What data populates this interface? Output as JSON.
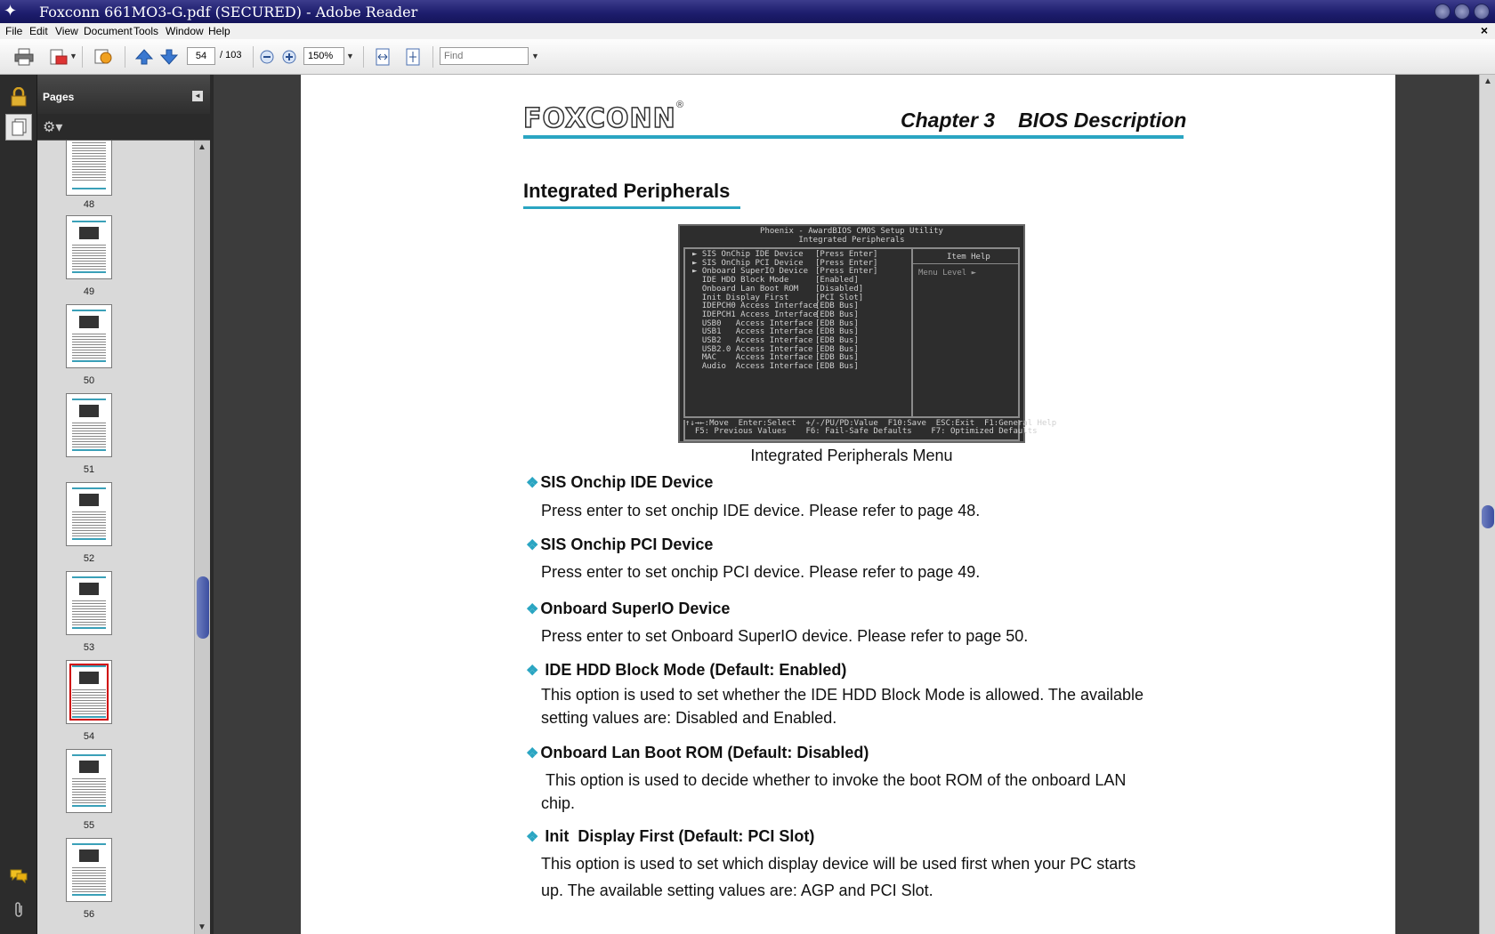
{
  "window": {
    "title": "Foxconn 661MO3-G.pdf (SECURED) - Adobe Reader"
  },
  "menu": [
    "File",
    "Edit",
    "View",
    "Document",
    "Tools",
    "Window",
    "Help"
  ],
  "toolbar": {
    "current_page": "54",
    "total_pages": "/ 103",
    "zoom": "150%",
    "find_placeholder": "Find"
  },
  "pages_panel": {
    "title": "Pages",
    "thumbnails": [
      "48",
      "49",
      "50",
      "51",
      "52",
      "53",
      "54",
      "55",
      "56"
    ],
    "selected": "54"
  },
  "doc": {
    "logo": "FOXCONN",
    "logo_mark": "®",
    "chapter": "Chapter 3",
    "chapter_title": "BIOS Description",
    "section": "Integrated Peripherals",
    "bios": {
      "title1": "Phoenix - AwardBIOS CMOS Setup Utility",
      "title2": "Integrated Peripherals",
      "rows": "► SIS OnChip IDE Device\n► SIS OnChip PCI Device\n► Onboard SuperIO Device\n  IDE HDD Block Mode\n  Onboard Lan Boot ROM\n  Init Display First\n  IDEPCH0 Access Interface\n  IDEPCH1 Access Interface\n  USB0   Access Interface\n  USB1   Access Interface\n  USB2   Access Interface\n  USB2.0 Access Interface\n  MAC    Access Interface\n  Audio  Access Interface",
      "values": "[Press Enter]\n[Press Enter]\n[Press Enter]\n[Enabled]\n[Disabled]\n[PCI Slot]\n[EDB Bus]\n[EDB Bus]\n[EDB Bus]\n[EDB Bus]\n[EDB Bus]\n[EDB Bus]\n[EDB Bus]\n[EDB Bus]",
      "help_title": "Item Help",
      "menu_level": "Menu Level   ►",
      "footer": "↑↓→←:Move  Enter:Select  +/-/PU/PD:Value  F10:Save  ESC:Exit  F1:General Help\n  F5: Previous Values    F6: Fail-Safe Defaults    F7: Optimized Defaults"
    },
    "caption": "Integrated Peripherals Menu",
    "options": [
      {
        "title": "SIS Onchip IDE Device",
        "desc": "Press enter to set onchip IDE device. Please refer to page 48."
      },
      {
        "title": "SIS Onchip PCI Device",
        "desc": "Press enter to set onchip PCI device.  Please refer to page 49."
      },
      {
        "title": "Onboard SuperIO Device",
        "desc": "Press enter to set Onboard SuperIO device. Please refer to page 50."
      },
      {
        "title": " IDE HDD Block Mode (Default: Enabled)",
        "desc": "This option is used to set whether the IDE HDD Block Mode is allowed. The available setting values are: Disabled and Enabled."
      },
      {
        "title": "Onboard Lan Boot ROM (Default: Disabled)",
        "desc": " This option is used to decide whether to invoke the boot ROM of the onboard LAN chip."
      },
      {
        "title": " Init  Display First (Default: PCI Slot)",
        "desc": "This option is used to set which display device will be used first when your PC starts up. The available setting values are: AGP and PCI Slot."
      }
    ]
  },
  "colors": {
    "accent": "#2aa5c2",
    "titlebar": "#1e1e6e",
    "selection": "#d00000"
  },
  "icons": [
    "app-star-icon",
    "print-icon",
    "email-icon",
    "collaborate-icon",
    "prev-page-icon",
    "next-page-icon",
    "zoom-out-icon",
    "zoom-in-icon",
    "fit-width-icon",
    "fit-page-icon",
    "lock-icon",
    "pages-icon",
    "comments-icon",
    "attachment-icon",
    "gear-icon"
  ]
}
